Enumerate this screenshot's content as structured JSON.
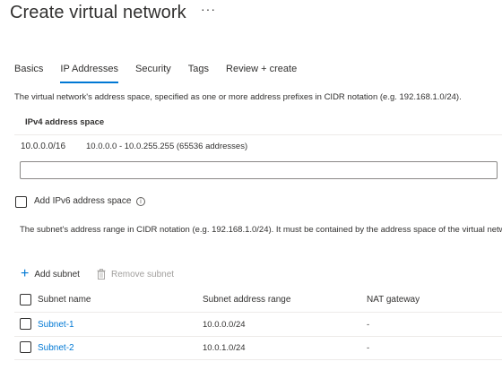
{
  "page": {
    "title": "Create virtual network",
    "more_icon": "more-icon"
  },
  "tabs": [
    {
      "label": "Basics",
      "active": false
    },
    {
      "label": "IP Addresses",
      "active": true
    },
    {
      "label": "Security",
      "active": false
    },
    {
      "label": "Tags",
      "active": false
    },
    {
      "label": "Review + create",
      "active": false
    }
  ],
  "ip_addresses": {
    "description": "The virtual network's address space, specified as one or more address prefixes in CIDR notation (e.g. 192.168.1.0/24).",
    "ipv4_header": "IPv4 address space",
    "address_space": {
      "prefix": "10.0.0.0/16",
      "range": "10.0.0.0 - 10.0.255.255 (65536 addresses)"
    },
    "new_address_value": "",
    "ipv6_checkbox": {
      "label": "Add IPv6 address space",
      "checked": false,
      "info_icon": "info-icon"
    },
    "subnet_description": "The subnet's address range in CIDR notation (e.g. 192.168.1.0/24). It must be contained by the address space of the virtual network."
  },
  "subnet_toolbar": {
    "add_label": "Add subnet",
    "remove_label": "Remove subnet"
  },
  "subnet_table": {
    "columns": [
      "Subnet name",
      "Subnet address range",
      "NAT gateway"
    ],
    "rows": [
      {
        "name": "Subnet-1",
        "range": "10.0.0.0/24",
        "nat": "-"
      },
      {
        "name": "Subnet-2",
        "range": "10.0.1.0/24",
        "nat": "-"
      }
    ]
  },
  "colors": {
    "accent": "#0078d4",
    "text": "#323130",
    "disabled": "#a19f9d",
    "divider": "#edebe9"
  }
}
